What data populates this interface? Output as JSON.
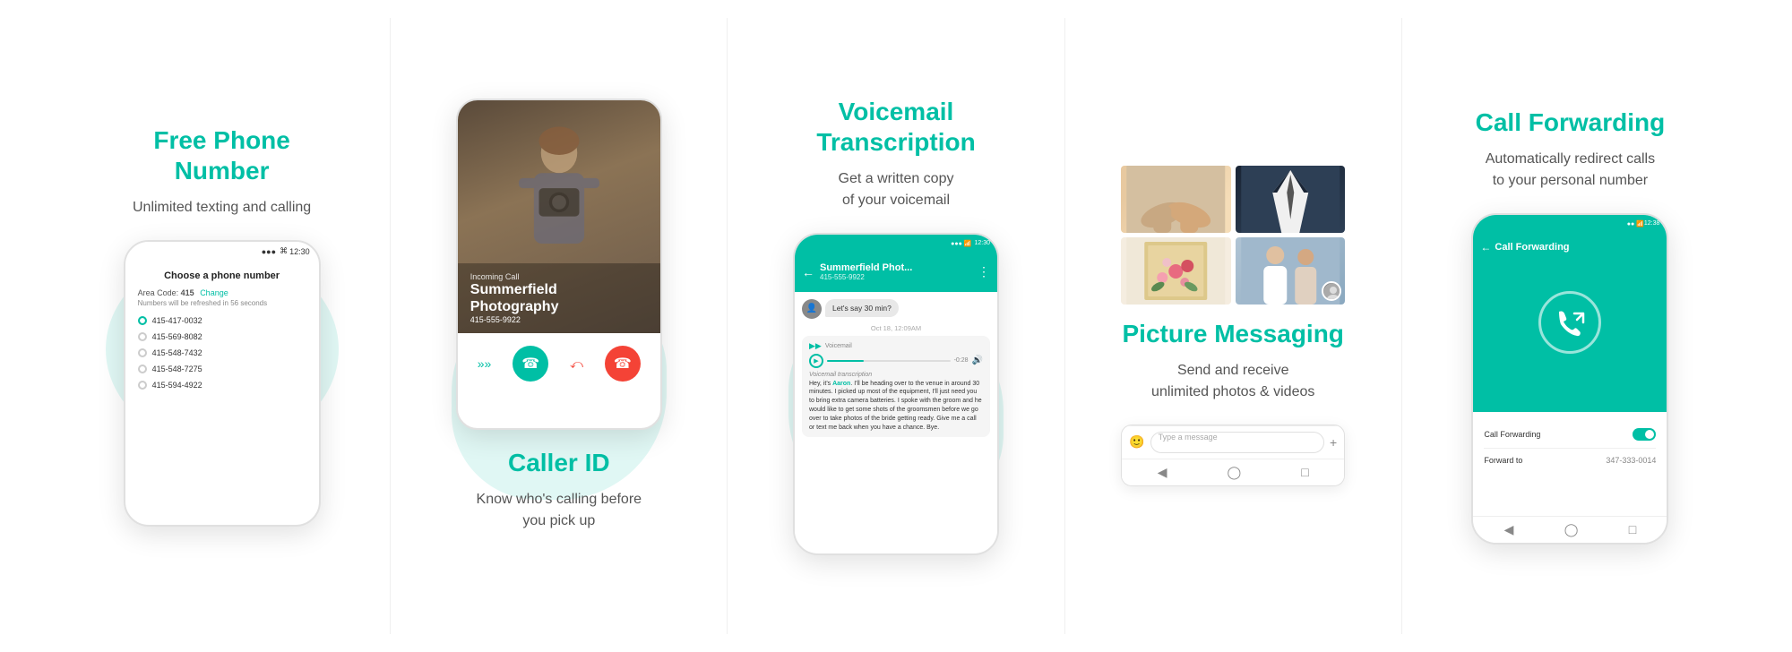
{
  "features": [
    {
      "id": "free-phone",
      "title": "Free Phone\nNumber",
      "description": "Unlimited texting and calling",
      "phone": {
        "status_bar": "12:30",
        "heading": "Choose a phone number",
        "area_code_label": "Area Code:",
        "area_code_value": "415",
        "change_label": "Change",
        "refresh_text": "Numbers will be refreshed in 56 seconds",
        "numbers": [
          {
            "value": "415-417-0032",
            "selected": true
          },
          {
            "value": "415-569-8082",
            "selected": false
          },
          {
            "value": "415-548-7432",
            "selected": false
          },
          {
            "value": "415-548-7275",
            "selected": false
          },
          {
            "value": "415-594-4922",
            "selected": false
          }
        ]
      }
    },
    {
      "id": "caller-id",
      "title": "Caller ID",
      "description": "Know who's calling before\nyou pick up",
      "phone": {
        "incoming_label": "Incoming Call",
        "caller_name": "Summerfield\nPhotography",
        "caller_number": "415-555-9922",
        "accept_label": "Accept",
        "decline_label": "Decline"
      }
    },
    {
      "id": "voicemail",
      "title": "Voicemail\nTranscription",
      "description": "Get a written copy\nof your voicemail",
      "phone": {
        "status_bar": "12:30",
        "contact_name": "Summerfield Phot...",
        "contact_number": "415-555-9922",
        "message_bubble": "Let's say 30 min?",
        "date_label": "Oct 18, 12:09AM",
        "voicemail_label": "Voicemail",
        "voicemail_duration": "-0:28",
        "transcript_label": "Voicemail transcription",
        "transcript_text": "Hey, it's Aaron. I'll be heading over to the venue in around 30 minutes. I picked up most of the equipment, I'll just need you to bring extra camera batteries. I spoke with the groom and he would like to get some shots of the groomsmen before we go over to take photos of the bride getting ready. Give me a call or text me back when you have a chance. Bye.",
        "highlight_name": "Aaron"
      }
    },
    {
      "id": "picture-messaging",
      "title": "Picture Messaging",
      "description": "Send and receive\nunlimited photos & videos",
      "phone": {
        "type_message_placeholder": "Type a message"
      }
    },
    {
      "id": "call-forwarding",
      "title": "Call Forwarding",
      "description": "Automatically redirect calls\nto your personal number",
      "phone": {
        "status_bar": "12:38",
        "header_title": "Call Forwarding",
        "forwarding_label": "Call Forwarding",
        "forward_to_label": "Forward to",
        "forward_number": "347-333-0014",
        "toggle_on": true
      }
    }
  ]
}
